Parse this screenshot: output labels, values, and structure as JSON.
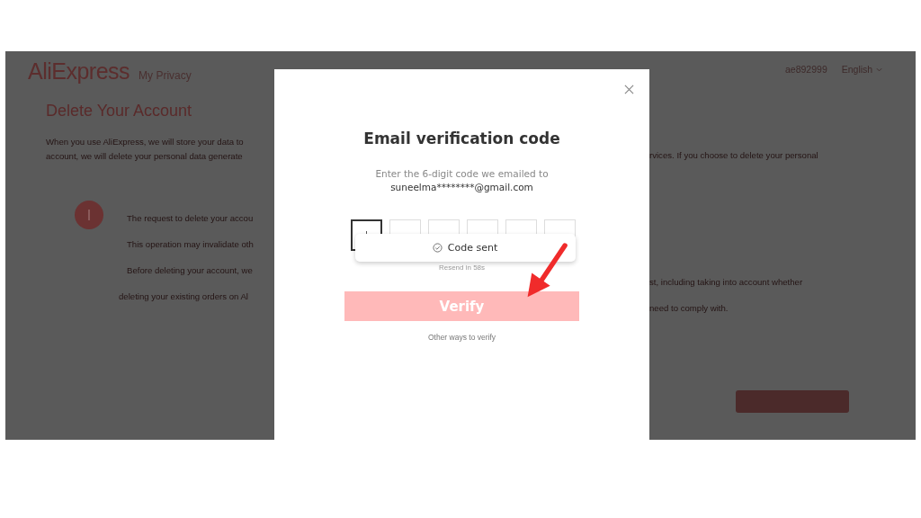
{
  "page": {
    "logo": "AliExpress",
    "section": "My Privacy",
    "user": "ae892999",
    "language": "English",
    "heading": "Delete Your Account",
    "intro_left": [
      "When you use AliExpress, we will store your data to",
      "account, we will delete your personal data generate"
    ],
    "intro_right": "rvices. If you choose to delete your personal",
    "notice_left": [
      "The request to delete your accou",
      "This operation may invalidate oth",
      "Before deleting your account, we",
      "deleting your existing orders on Al"
    ],
    "notice_right": [
      "st, including taking into account whether",
      "need to comply with."
    ]
  },
  "dialog": {
    "title": "Email verification code",
    "prompt": "Enter the 6-digit code we emailed to",
    "email": "suneelma********@gmail.com",
    "code_boxes": [
      {
        "focused": true
      },
      {
        "focused": false
      },
      {
        "focused": false
      },
      {
        "focused": false
      },
      {
        "focused": false
      },
      {
        "focused": false
      }
    ],
    "toast": "Code sent",
    "resend": "Resend in 58s",
    "verify_button": "Verify",
    "other_link": "Other ways to verify"
  }
}
